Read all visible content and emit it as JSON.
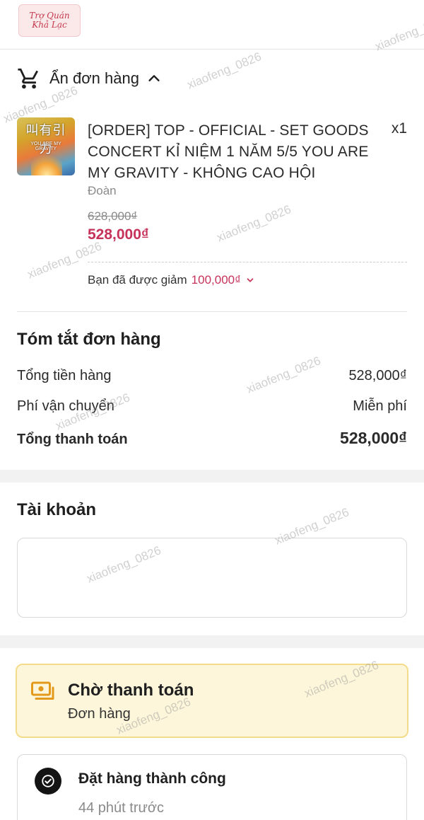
{
  "logo": {
    "alt": "Trợ Quán Khả Lạc"
  },
  "order_toggle": {
    "label": "Ẩn đơn hàng"
  },
  "product": {
    "title": "[ORDER] TOP - OFFICIAL - SET GOODS CONCERT KỈ NIỆM 1 NĂM 5/5 YOU ARE MY GRAVITY - KHÔNG CAO HỘI",
    "quantity": "x1",
    "variant": "Đoàn",
    "original_price": "628,000₫",
    "price": "528,000₫",
    "thumbnail_text": "叫有引力",
    "thumbnail_subtext": "YOU ARE MY GRAVITY"
  },
  "discount": {
    "label": "Bạn đã được giảm",
    "amount": "100,000₫"
  },
  "summary": {
    "title": "Tóm tắt đơn hàng",
    "rows": [
      {
        "label": "Tổng tiền hàng",
        "value": "528,000₫"
      },
      {
        "label": "Phí vận chuyển",
        "value": "Miễn phí"
      },
      {
        "label": "Tổng thanh toán",
        "value": "528,000₫"
      }
    ]
  },
  "account": {
    "title": "Tài khoản"
  },
  "status": {
    "title": "Chờ thanh toán",
    "subtitle": "Đơn hàng"
  },
  "timeline": {
    "title": "Đặt hàng thành công",
    "time": "44 phút trước"
  },
  "watermark": "xiaofeng_0826",
  "colors": {
    "accent_price": "#c6325a",
    "status_bg": "#fdf6da",
    "status_border": "#f3dc8a",
    "status_icon": "#e39a1c"
  }
}
